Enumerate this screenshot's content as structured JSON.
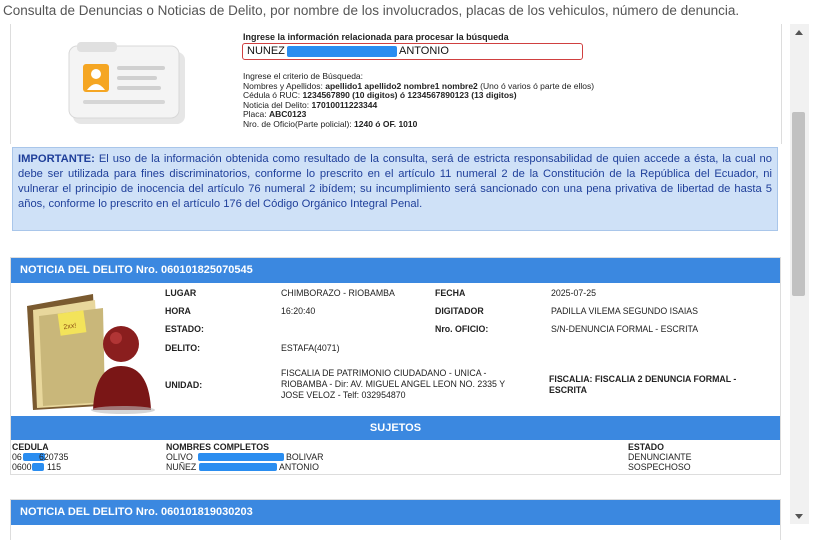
{
  "page": {
    "title": "Consulta de Denuncias o Noticias de Delito, por nombre de los involucrados, placas de los vehiculos, número de denuncia."
  },
  "search": {
    "label": "Ingrese la información relacionada para procesar la búsqueda",
    "value_prefix": "NUNEZ",
    "value_suffix": "ANTONIO",
    "criteria_title": "Ingrese el criterio de Búsqueda:",
    "criteria": [
      {
        "label": "Nombres y Apellidos:",
        "value": "apellido1 apellido2 nombre1 nombre2",
        "note": "(Uno ó varios ó parte de ellos)"
      },
      {
        "label": "Cédula ó RUC:",
        "value": "1234567890 (10 digitos) ó 1234567890123 (13 digitos)",
        "note": ""
      },
      {
        "label": "Noticia del Delito:",
        "value": "17010011223344",
        "note": ""
      },
      {
        "label": "Placa:",
        "value": "ABC0123",
        "note": ""
      },
      {
        "label": "Nro. de Oficio(Parte policial):",
        "value": "1240 ó OF. 1010",
        "note": ""
      }
    ]
  },
  "important": {
    "heading": "IMPORTANTE:",
    "text": "El uso de la información obtenida como resultado de la consulta, será de estricta responsabilidad de quien accede a ésta, la cual no debe ser utilizada para fines discriminatorios, conforme lo prescrito en el artículo 11 numeral 2 de la Constitución de la República del Ecuador, ni vulnerar el principio de inocencia del artículo 76 numeral 2 ibídem; su incumplimiento será sancionado con una pena privativa de libertad de hasta 5 años, conforme lo prescrito en el artículo 176 del Código Orgánico Integral Penal."
  },
  "noticias": [
    {
      "header": "NOTICIA DEL DELITO Nro. 060101825070545",
      "labels": {
        "lugar": "LUGAR",
        "fecha": "FECHA",
        "hora": "HORA",
        "digitador": "DIGITADOR",
        "estado": "ESTADO:",
        "oficio": "Nro. OFICIO:",
        "delito": "DELITO:",
        "unidad": "UNIDAD:"
      },
      "lugar": "CHIMBORAZO - RIOBAMBA",
      "fecha": "2025-07-25",
      "hora": "16:20:40",
      "digitador": "PADILLA VILEMA SEGUNDO ISAIAS",
      "estado": "",
      "oficio": "S/N-DENUNCIA FORMAL - ESCRITA",
      "delito": "ESTAFA(4071)",
      "unidad_lines": [
        "FISCALIA DE PATRIMONIO CIUDADANO - UNICA -",
        "RIOBAMBA - Dir: AV. MIGUEL ANGEL LEON NO. 2335 Y",
        "JOSE VELOZ - Telf: 032954870"
      ],
      "fiscalia_lines": [
        "FISCALIA: FISCALIA 2 DENUNCIA FORMAL -",
        "ESCRITA"
      ],
      "sujetos_title": "SUJETOS",
      "sujetos_headers": {
        "cedula": "CEDULA",
        "nombres": "NOMBRES COMPLETOS",
        "estado": "ESTADO"
      },
      "sujetos": [
        {
          "cedula_a": "06",
          "cedula_b": "620735",
          "nombre_a": "OLIVO",
          "nombre_b": "BOLIVAR",
          "estado": "DENUNCIANTE"
        },
        {
          "cedula_a": "0600",
          "cedula_b": "115",
          "nombre_a": "NUÑEZ",
          "nombre_b": "ANTONIO",
          "estado": "SOSPECHOSO"
        }
      ]
    },
    {
      "header": "NOTICIA DEL DELITO Nro. 060101819030203"
    }
  ],
  "colors": {
    "header_blue": "#3b88e0",
    "important_bg": "#cfe1f7",
    "important_text": "#1f3f9a",
    "redaction": "#2a8df0",
    "input_border": "#d04040"
  },
  "icons": {
    "folder": "folder-card-icon",
    "person": "folder-person-icon",
    "scroll_up": "scroll-up-icon",
    "scroll_down": "scroll-down-icon"
  }
}
